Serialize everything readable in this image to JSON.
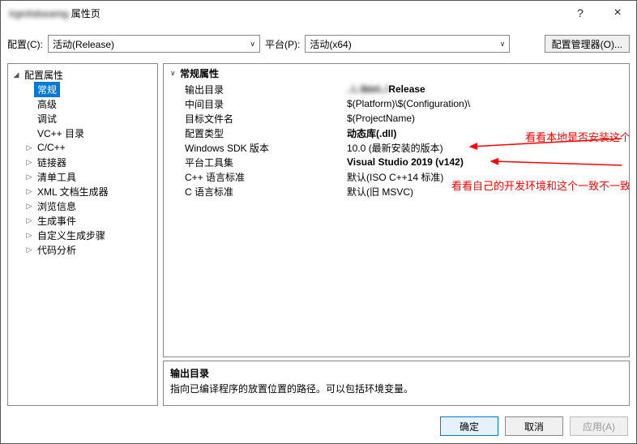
{
  "window": {
    "title_blur": "Irgmhdseamg",
    "title_suffix": " 属性页",
    "help_icon": "?",
    "close_icon": "×"
  },
  "config_row": {
    "config_label": "配置(C):",
    "config_value": "活动(Release)",
    "platform_label": "平台(P):",
    "platform_value": "活动(x64)",
    "cfg_mgr_label": "配置管理器(O)..."
  },
  "tree": {
    "root": {
      "exp": "◢",
      "label": "配置属性"
    },
    "items": [
      {
        "exp": "",
        "label": "常规",
        "selected": true
      },
      {
        "exp": "",
        "label": "高级"
      },
      {
        "exp": "",
        "label": "调试"
      },
      {
        "exp": "",
        "label": "VC++ 目录"
      },
      {
        "exp": "▷",
        "label": "C/C++"
      },
      {
        "exp": "▷",
        "label": "链接器"
      },
      {
        "exp": "▷",
        "label": "清单工具"
      },
      {
        "exp": "▷",
        "label": "XML 文档生成器"
      },
      {
        "exp": "▷",
        "label": "浏览信息"
      },
      {
        "exp": "▷",
        "label": "生成事件"
      },
      {
        "exp": "▷",
        "label": "自定义生成步骤"
      },
      {
        "exp": "▷",
        "label": "代码分析"
      }
    ]
  },
  "props": {
    "header_exp": "∨",
    "header": "常规属性",
    "rows": [
      {
        "name": "输出目录",
        "value_blur": "..\\..\\bin\\..\\",
        "value_suffix": "Release",
        "bold": true
      },
      {
        "name": "中间目录",
        "value": "$(Platform)\\$(Configuration)\\",
        "bold": false
      },
      {
        "name": "目标文件名",
        "value": "$(ProjectName)",
        "bold": false
      },
      {
        "name": "配置类型",
        "value": "动态库(.dll)",
        "bold": true
      },
      {
        "name": "Windows SDK 版本",
        "value": "10.0 (最新安装的版本)",
        "bold": false
      },
      {
        "name": "平台工具集",
        "value": "Visual Studio 2019 (v142)",
        "bold": true
      },
      {
        "name": "C++ 语言标准",
        "value": "默认(ISO C++14 标准)",
        "bold": false
      },
      {
        "name": "C 语言标准",
        "value": "默认(旧 MSVC)",
        "bold": false
      }
    ]
  },
  "annotations": {
    "a1": "看看本地是否安装这个",
    "a2": "看看自己的开发环境和这个一致不一致"
  },
  "help": {
    "title": "输出目录",
    "desc": "指向已编译程序的放置位置的路径。可以包括环境变量。"
  },
  "buttons": {
    "ok": "确定",
    "cancel": "取消",
    "apply": "应用(A)"
  }
}
